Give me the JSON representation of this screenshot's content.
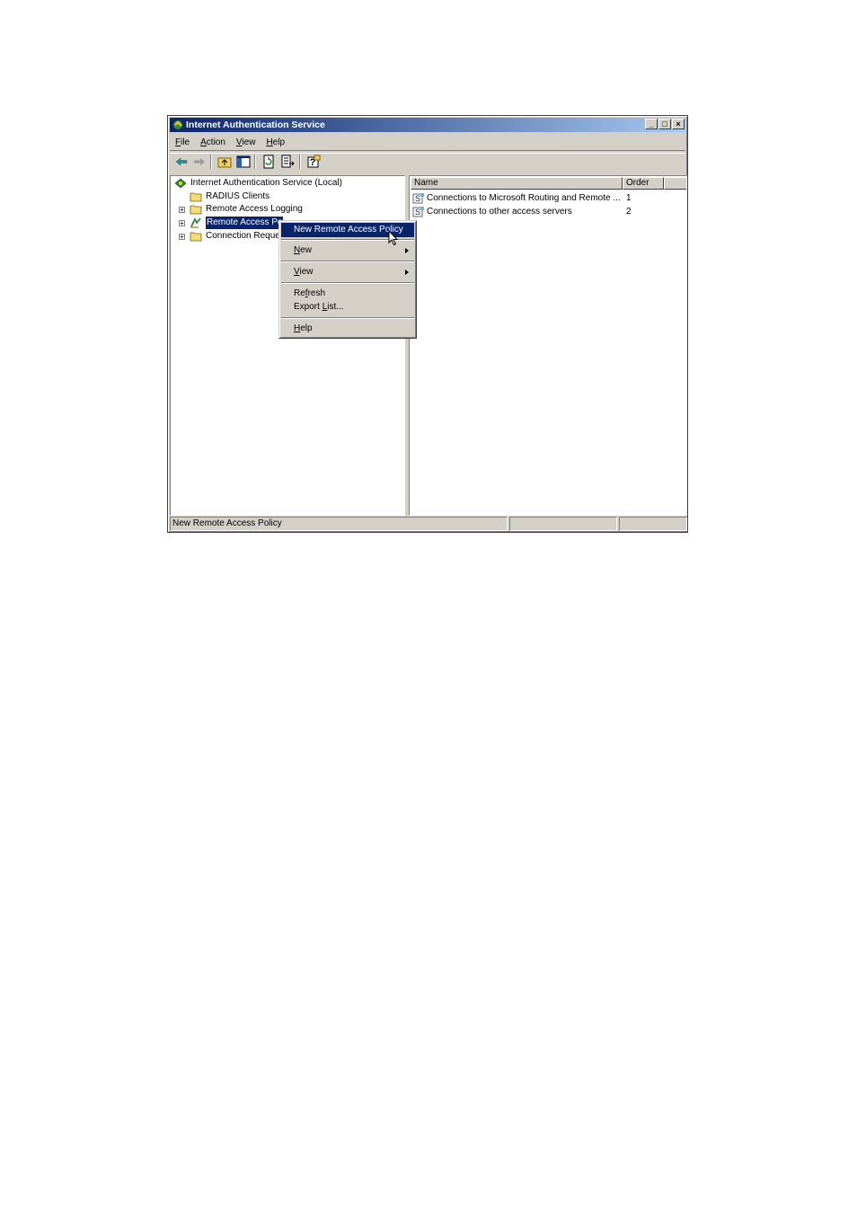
{
  "window": {
    "title": "Internet Authentication Service",
    "controls": [
      "minimize-icon",
      "maximize-icon",
      "close-icon"
    ]
  },
  "menubar": [
    {
      "label": "File",
      "mnemonic": "F",
      "rest": "ile"
    },
    {
      "label": "Action",
      "mnemonic": "A",
      "rest": "ction"
    },
    {
      "label": "View",
      "mnemonic": "V",
      "rest": "iew"
    },
    {
      "label": "Help",
      "mnemonic": "H",
      "rest": "elp"
    }
  ],
  "toolbar": [
    "back-arrow-icon",
    "forward-arrow-icon",
    "up-folder-icon",
    "show-hide-tree-icon",
    "refresh-icon",
    "export-list-icon",
    "help-icon"
  ],
  "tree": {
    "root": "Internet Authentication Service (Local)",
    "items": [
      {
        "label": "RADIUS Clients",
        "icon": "folder-icon",
        "expandable": false
      },
      {
        "label": "Remote Access Logging",
        "icon": "folder-icon",
        "expandable": true
      },
      {
        "label": "Remote Access Po",
        "icon": "policy-icon",
        "expandable": true,
        "selected": true
      },
      {
        "label": "Connection Reque",
        "icon": "folder-icon",
        "expandable": true
      }
    ]
  },
  "list": {
    "columns": [
      "Name",
      "Order"
    ],
    "rows": [
      {
        "name": "Connections to Microsoft Routing and Remote ...",
        "order": "1"
      },
      {
        "name": "Connections to other access servers",
        "order": "2"
      }
    ]
  },
  "context_menu": {
    "items": [
      {
        "label": "New Remote Access Policy",
        "highlighted": true
      },
      {
        "label": "New",
        "mnemonic": "N",
        "rest": "ew",
        "submenu": true
      },
      {
        "label": "View",
        "mnemonic": "V",
        "rest": "iew",
        "submenu": true
      },
      {
        "label": "Refresh",
        "pre": "Re",
        "mnemonic": "f",
        "rest": "resh"
      },
      {
        "label": "Export List...",
        "pre": "Export ",
        "mnemonic": "L",
        "rest": "ist..."
      },
      {
        "label": "Help",
        "mnemonic": "H",
        "rest": "elp"
      }
    ]
  },
  "statusbar": {
    "text": "New Remote Access Policy"
  },
  "colors": {
    "title_start": "#0a246a",
    "title_end": "#a6caf0",
    "face": "#d4d0c8",
    "highlight": "#0a246a"
  }
}
